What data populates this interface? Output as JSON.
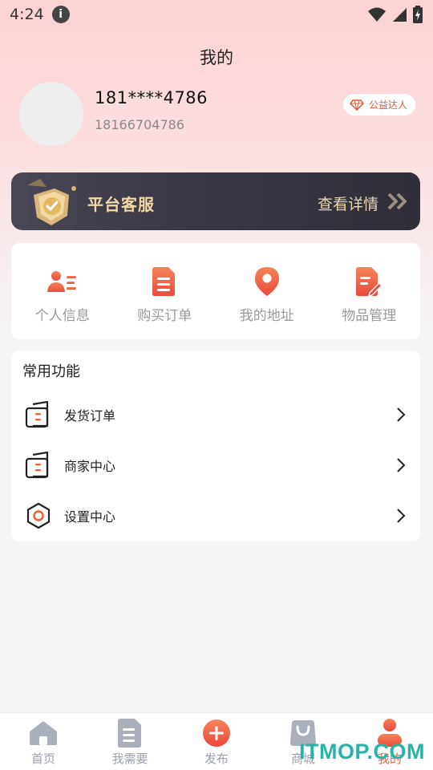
{
  "status_bar": {
    "time": "4:24",
    "info_glyph": "i"
  },
  "header": {
    "title": "我的"
  },
  "profile": {
    "masked_phone": "181****4786",
    "full_phone": "18166704786",
    "badge_label": "公益达人",
    "badge_icon": "diamond-icon"
  },
  "service_banner": {
    "title": "平台客服",
    "detail_label": "查看详情"
  },
  "quick_actions": [
    {
      "label": "个人信息",
      "icon": "user-info-icon"
    },
    {
      "label": "购买订单",
      "icon": "order-document-icon"
    },
    {
      "label": "我的地址",
      "icon": "location-pin-icon"
    },
    {
      "label": "物品管理",
      "icon": "edit-document-icon"
    }
  ],
  "common_functions": {
    "title": "常用功能",
    "items": [
      {
        "label": "发货订单",
        "icon": "wallet-doc-icon"
      },
      {
        "label": "商家中心",
        "icon": "wallet-doc-icon"
      },
      {
        "label": "设置中心",
        "icon": "hexagon-settings-icon"
      }
    ]
  },
  "tabbar": {
    "tabs": [
      {
        "label": "首页",
        "icon": "home-icon",
        "active": false
      },
      {
        "label": "我需要",
        "icon": "document-icon",
        "active": false
      },
      {
        "label": "发布",
        "icon": "plus-circle-icon",
        "active": false
      },
      {
        "label": "商城",
        "icon": "shopping-bag-icon",
        "active": false
      },
      {
        "label": "我的",
        "icon": "person-icon",
        "active": true
      }
    ]
  },
  "watermark": {
    "text": "ITMOP.COM"
  },
  "colors": {
    "accent": "#f0603b",
    "banner_gold": "#f3d9a8",
    "tab_inactive": "#9aa0ad",
    "header_pink": "#fcd2d3",
    "watermark": "#27b3a6"
  }
}
